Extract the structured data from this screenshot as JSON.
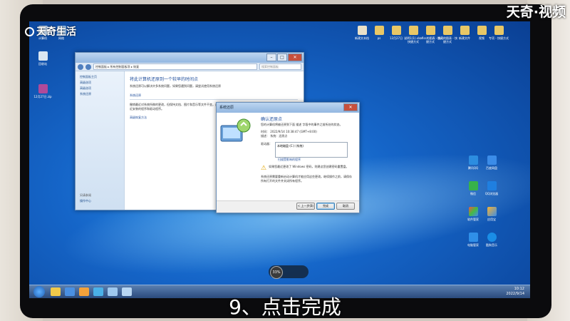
{
  "watermark": {
    "brand_left": "天奇生活",
    "brand_right": "天奇·视频"
  },
  "caption": "9、点击完成",
  "desktop_icons_left": [
    {
      "label": "计算机",
      "name": "computer-icon"
    },
    {
      "label": "网络",
      "name": "network-icon"
    },
    {
      "label": "回收站",
      "name": "recycle-bin-icon"
    },
    {
      "label": "12月27日.zip",
      "name": "zip-archive-icon"
    }
  ],
  "desktop_icons_top": [
    {
      "label": "新建文本档",
      "name": "text-file-icon"
    },
    {
      "label": "ps",
      "name": "folder-icon"
    },
    {
      "label": "12月27日",
      "name": "folder-icon"
    },
    {
      "label": "说明1(1).xls - 快捷方式",
      "name": "shortcut-icon"
    },
    {
      "label": "ofiss的图表 - 快捷方式",
      "name": "shortcut-icon"
    },
    {
      "label": "隐藏的图表 - 快捷方式",
      "name": "shortcut-icon"
    },
    {
      "label": "新建文件",
      "name": "file-icon"
    },
    {
      "label": "视频",
      "name": "video-icon"
    },
    {
      "label": "专项 - 快捷方式",
      "name": "shortcut-icon"
    }
  ],
  "desktop_icons_right": [
    {
      "label": "腾讯QQ",
      "name": "qq-icon"
    },
    {
      "label": "百度网盘",
      "name": "baidu-netdisk-icon"
    },
    {
      "label": "微信",
      "name": "wechat-icon"
    },
    {
      "label": "QQ浏览器",
      "name": "qq-browser-icon"
    },
    {
      "label": "软件管家",
      "name": "software-manager-icon"
    },
    {
      "label": "应用宝",
      "name": "app-store-icon"
    },
    {
      "label": "电脑管家",
      "name": "pc-manager-icon"
    },
    {
      "label": "酷狗音乐",
      "name": "kugou-music-icon"
    }
  ],
  "control_panel": {
    "breadcrumb": "控制面板 ▸ 所有控制面板项 ▸ 恢复",
    "search_placeholder": "搜索控制面板",
    "side_links": [
      "控制面板主页",
      "高级选项",
      "高级选项",
      "系统还原"
    ],
    "side_bottom": [
      "另请参阅",
      "操作中心"
    ],
    "heading": "将此计算机还原到一个较早的时间点",
    "intro": "系统还原可以解决许多系统问题，如果您遇到问题，请尝试使用系统还原",
    "section_title": "系统还原",
    "section_text": "撤销最近对系统所做的更改，但保持文档、图片和音乐等文件不变。这可能会删除最近安装的程序和驱动程序。",
    "open_restore_button": "打开系统还原(S)",
    "advanced_link": "高级恢复方法"
  },
  "dialog": {
    "title": "系统还原",
    "heading": "确认还原点",
    "subtitle": "您的计算机将被还原到下面 描述 字段中的事件之前所处的状态。",
    "time_label": "时间：",
    "time_value": "2022/9/14 10:38:47 (GMT+8:00)",
    "desc_label": "描述：",
    "desc_value": "系统：还原点",
    "drives_label": "驱动器：",
    "drives_value": "本地磁盘 (C:) (系统)",
    "scan_link": "扫描受影响的程序",
    "warning": "如果您最近更改了 Windows 密码，则建议您创建密码重置盘。",
    "confirm_text": "系统还原需要重新启动计算机才能应用这些更改。继续操作之前，请保存所有打开的文件并关闭所有程序。",
    "back_button": "< 上一步(B)",
    "finish_button": "完成",
    "cancel_button": "取消"
  },
  "taskbar": {
    "time": "10:12",
    "date": "2022/9/14",
    "tray_badge": "33%"
  }
}
